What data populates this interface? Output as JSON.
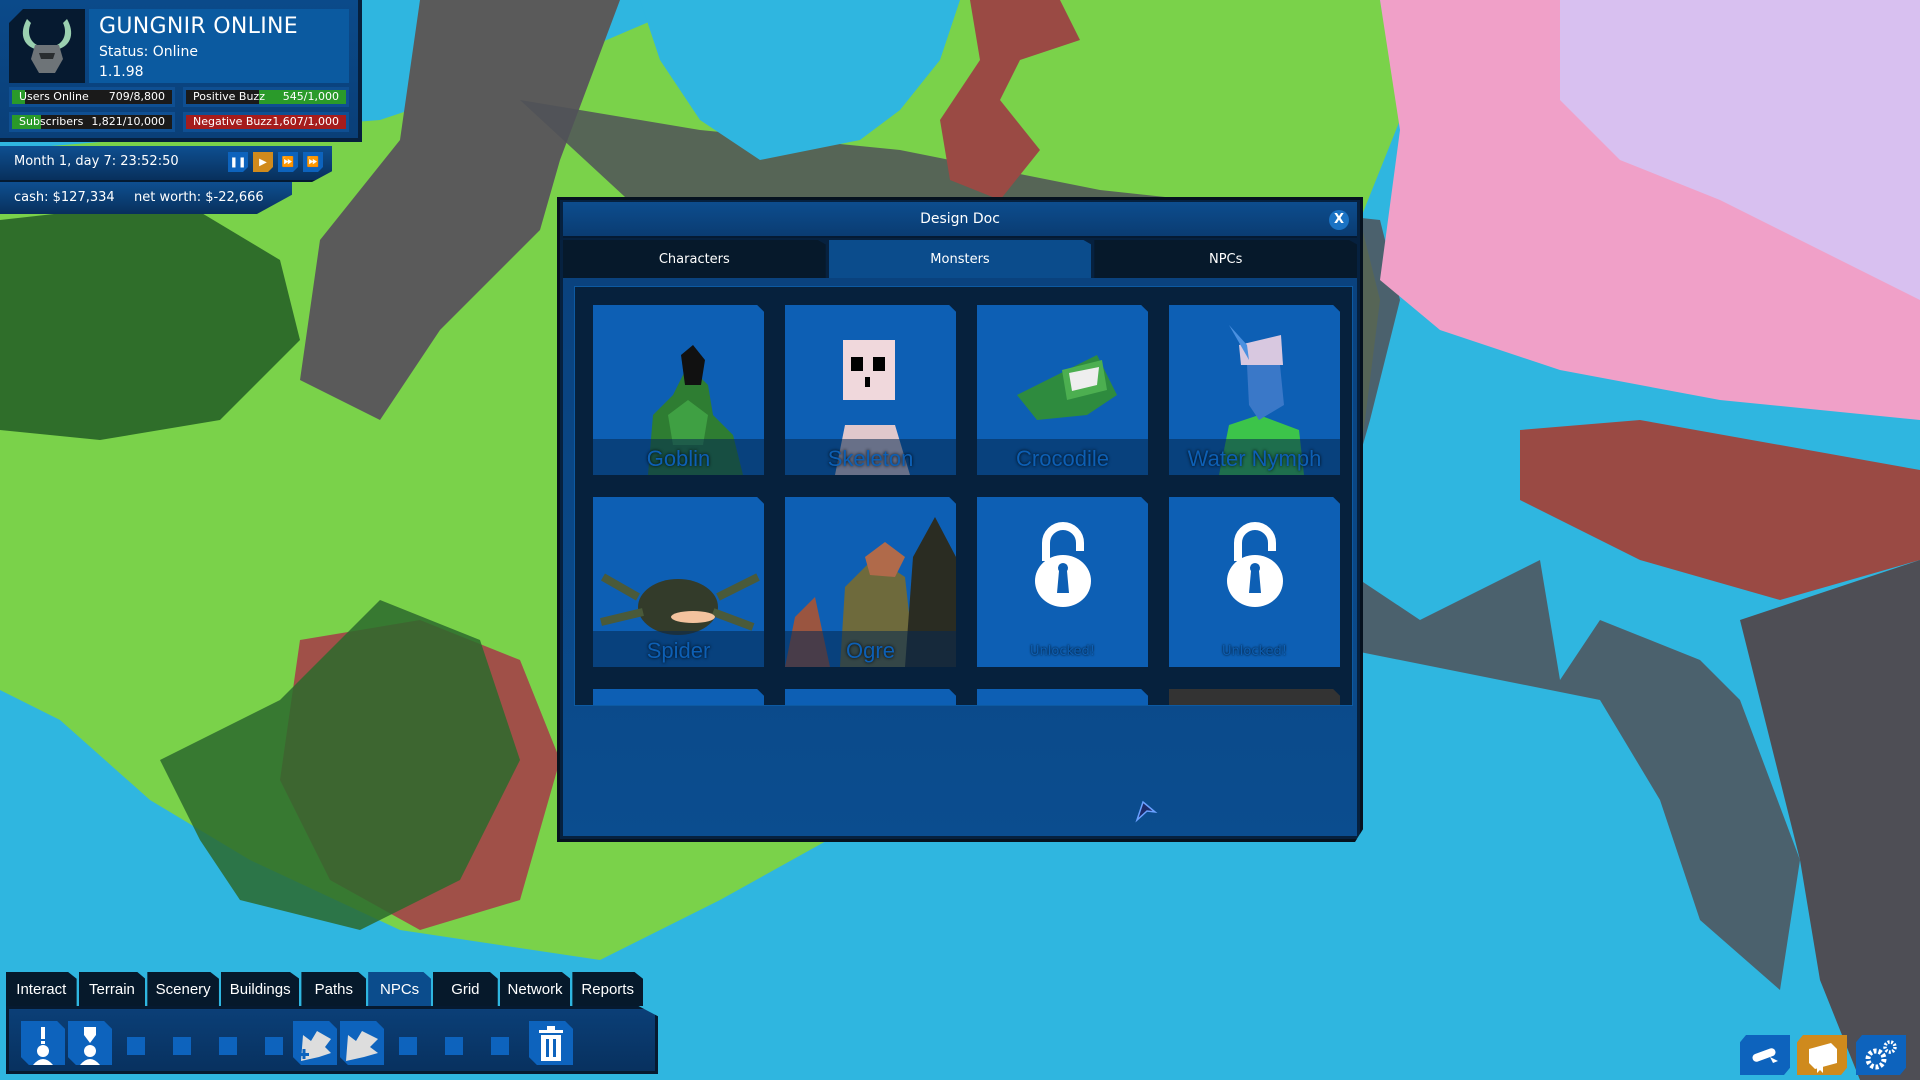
{
  "hud": {
    "title": "GUNGNIR ONLINE",
    "status": "Status: Online",
    "version": "1.1.98",
    "stats": {
      "users_online": {
        "label": "Users Online",
        "value": "709/8,800",
        "fraction": 0.08
      },
      "subscribers": {
        "label": "Subscribers",
        "value": "1,821/10,000",
        "fraction": 0.18
      },
      "positive_buzz": {
        "label": "Positive Buzz",
        "value": "545/1,000",
        "fraction": 0.545
      },
      "negative_buzz": {
        "label": "Negative Buzz",
        "value": "1,607/1,000",
        "fraction": 1.0
      }
    },
    "colors": {
      "positive": "#2a9a2a",
      "negative": "#a51c1c"
    }
  },
  "time": {
    "label": "Month 1, day 7: 23:52:50",
    "controls": [
      "pause",
      "play",
      "fast-forward",
      "fastest"
    ],
    "active": "play"
  },
  "finance": {
    "cash": "cash: $127,334",
    "net_worth": "net worth: $-22,666"
  },
  "design_doc": {
    "title": "Design Doc",
    "close_label": "X",
    "tabs": [
      {
        "label": "Characters",
        "active": false
      },
      {
        "label": "Monsters",
        "active": true
      },
      {
        "label": "NPCs",
        "active": false
      }
    ],
    "cards": [
      {
        "name": "Goblin",
        "state": "monster"
      },
      {
        "name": "Skeleton",
        "state": "monster"
      },
      {
        "name": "Crocodile",
        "state": "monster"
      },
      {
        "name": "Water Nymph",
        "state": "monster"
      },
      {
        "name": "Spider",
        "state": "monster"
      },
      {
        "name": "Ogre",
        "state": "monster"
      },
      {
        "name": "Unlocked!",
        "state": "unlocked"
      },
      {
        "name": "Unlocked!",
        "state": "unlocked"
      },
      {
        "name": "",
        "state": "unlocked"
      },
      {
        "name": "",
        "state": "unlocked"
      },
      {
        "name": "",
        "state": "unlocked"
      },
      {
        "name": "",
        "state": "disabled"
      }
    ]
  },
  "toolbar": {
    "tabs": [
      {
        "label": "Interact",
        "active": false
      },
      {
        "label": "Terrain",
        "active": false
      },
      {
        "label": "Scenery",
        "active": false
      },
      {
        "label": "Buildings",
        "active": false
      },
      {
        "label": "Paths",
        "active": false
      },
      {
        "label": "NPCs",
        "active": true
      },
      {
        "label": "Grid",
        "active": false
      },
      {
        "label": "Network",
        "active": false
      },
      {
        "label": "Reports",
        "active": false
      }
    ],
    "tools": [
      "npc-alert-icon",
      "npc-guard-icon",
      "empty",
      "empty",
      "empty",
      "empty",
      "add-monster-icon",
      "monster-icon",
      "empty",
      "empty",
      "empty",
      "trash-icon"
    ]
  },
  "corner_buttons": [
    {
      "icon": "diploma-icon",
      "color": "#0d63bd"
    },
    {
      "icon": "design-doc-book-icon",
      "color": "#cf8a1d"
    },
    {
      "icon": "settings-gears-icon",
      "color": "#0d63bd"
    }
  ]
}
